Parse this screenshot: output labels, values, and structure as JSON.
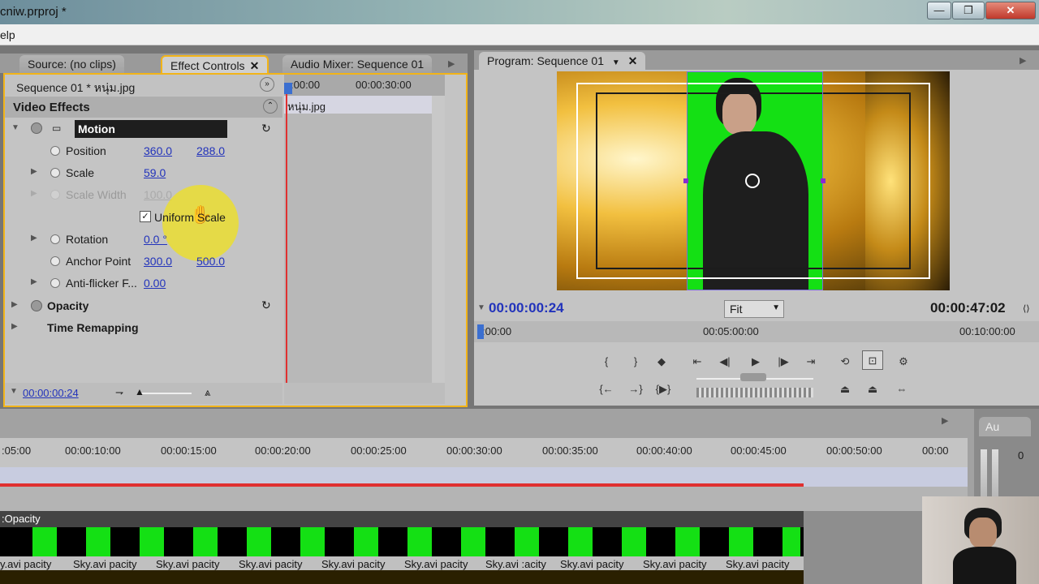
{
  "window": {
    "title": "cniw.prproj *",
    "minimize": "—",
    "maximize": "❐",
    "close": "✕"
  },
  "menu": {
    "help": "elp"
  },
  "left_panel": {
    "tabs": [
      {
        "label": "Source: (no clips)"
      },
      {
        "label": "Effect Controls",
        "close": "✕"
      },
      {
        "label": "Audio Mixer: Sequence 01"
      }
    ],
    "sequence_label": "Sequence 01 * หนุ่ม.jpg",
    "clip_name": "หนุ่ม.jpg",
    "ruler": {
      "start": ":00:00",
      "mid": "00:00:30:00"
    },
    "video_effects": "Video Effects",
    "motion": "Motion",
    "properties": [
      {
        "label": "Position",
        "v1": "360.0",
        "v2": "288.0"
      },
      {
        "label": "Scale",
        "v1": "59.0"
      },
      {
        "label": "Scale Width",
        "v1": "100.0"
      },
      {
        "label": "Rotation",
        "v1": "0.0 °"
      },
      {
        "label": "Anchor Point",
        "v1": "300.0",
        "v2": "500.0"
      },
      {
        "label": "Anti-flicker F...",
        "v1": "0.00"
      }
    ],
    "uniform_scale": "Uniform Scale",
    "opacity": "Opacity",
    "time_remapping": "Time Remapping",
    "timecode": "00:00:00:24"
  },
  "program_panel": {
    "tab": "Program: Sequence 01",
    "current_time": "00:00:00:24",
    "duration": "00:00:47:02",
    "fit": "Fit",
    "ruler": [
      ":00:00",
      "00:05:00:00",
      "00:10:00:00"
    ]
  },
  "timeline": {
    "ruler": [
      ":05:00",
      "00:00:10:00",
      "00:00:15:00",
      "00:00:20:00",
      "00:00:25:00",
      "00:00:30:00",
      "00:00:35:00",
      "00:00:40:00",
      "00:00:45:00",
      "00:00:50:00",
      "00:00"
    ],
    "track_label": ":Opacity",
    "clip_labels": [
      "y.avi pacity",
      "Sky.avi pacity",
      "Sky.avi pacity",
      "Sky.avi pacity",
      "Sky.avi pacity",
      "Sky.avi pacity",
      "Sky.avi :acity",
      "Sky.avi pacity",
      "Sky.avi pacity",
      "Sky.avi pacity"
    ]
  },
  "audio_panel": {
    "tab": "Au",
    "level": "0"
  },
  "colors": {
    "accent_blue": "#2233bb",
    "green_screen": "#14e014",
    "playhead": "#e03030",
    "panel_highlight": "#f2b418"
  }
}
